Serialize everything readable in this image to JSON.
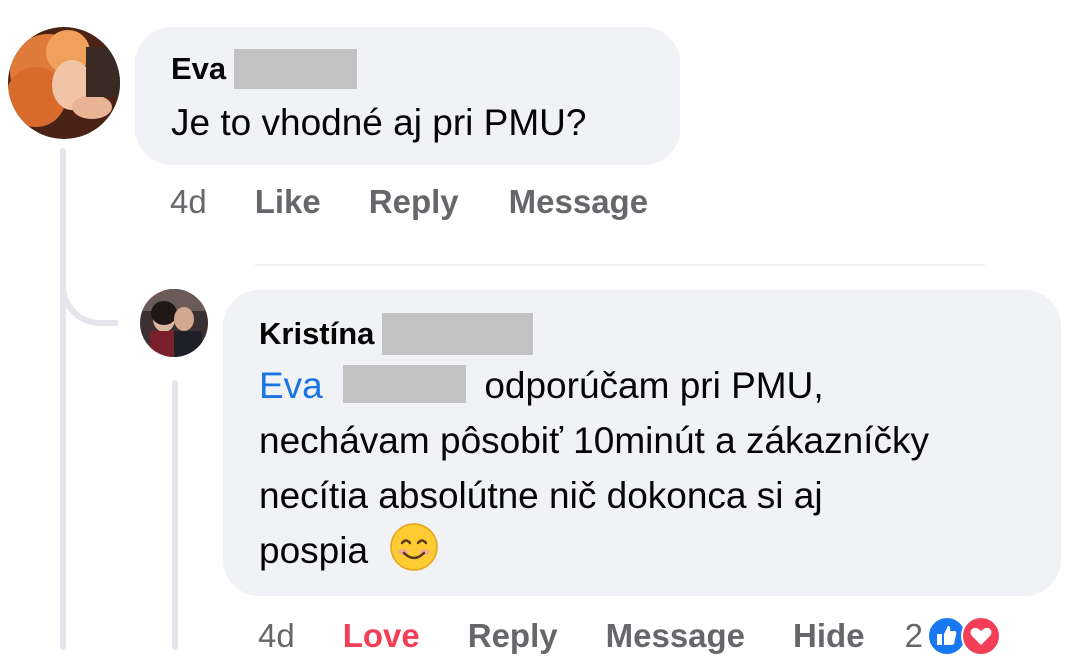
{
  "comment": {
    "author_name": "Eva",
    "text": "Je to vhodné aj pri PMU?",
    "actions": {
      "time": "4d",
      "like": "Like",
      "reply": "Reply",
      "message": "Message"
    }
  },
  "reply": {
    "author_name": "Kristína",
    "mention": "Eva",
    "text_line1": "odporúčam pri PMU,",
    "text_line2": "nechávam pôsobiť 10minút a zákazníčky",
    "text_line3": "necítia absolútne nič dokonca si aj",
    "text_line4": "pospia",
    "actions": {
      "time": "4d",
      "love": "Love",
      "reply": "Reply",
      "message": "Message",
      "hide": "Hide",
      "reaction_count": "2"
    }
  },
  "colors": {
    "bubble": "#f0f2f5",
    "action_text": "#65676b",
    "love": "#f33e58",
    "mention": "#1b74e4",
    "like_reaction": "#1877f2"
  },
  "icons": [
    "smiling-face-emoji",
    "like-reaction-icon",
    "love-reaction-icon"
  ]
}
